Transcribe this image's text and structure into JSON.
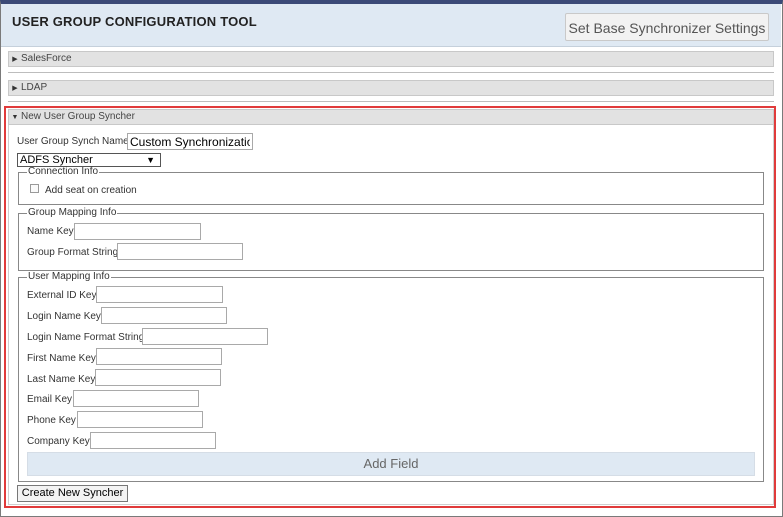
{
  "app": {
    "title": "USER GROUP CONFIGURATION TOOL",
    "base_settings_label": "Set Base Synchronizer Settings"
  },
  "accordions": [
    {
      "label": "SalesForce",
      "expanded": false
    },
    {
      "label": "LDAP",
      "expanded": false
    },
    {
      "label": "New User Group Syncher",
      "expanded": true
    }
  ],
  "form": {
    "synch_name_label": "User Group Synch Name",
    "synch_name_value": "Custom Synchronization",
    "syncher_type": "ADFS Syncher",
    "connection": {
      "legend": "Connection Info",
      "add_seat_label": "Add seat on creation",
      "add_seat_checked": false
    },
    "group_mapping": {
      "legend": "Group Mapping Info",
      "name_key_label": "Name Key",
      "name_key_value": "",
      "group_format_label": "Group Format String",
      "group_format_value": ""
    },
    "user_mapping": {
      "legend": "User Mapping Info",
      "external_id_label": "External ID Key",
      "login_name_label": "Login Name Key",
      "login_format_label": "Login Name Format String",
      "first_name_label": "First Name Key",
      "last_name_label": "Last Name Key",
      "email_label": "Email Key",
      "phone_label": "Phone Key",
      "company_label": "Company Key"
    },
    "add_field_label": "Add Field",
    "create_label": "Create New Syncher"
  },
  "colors": {
    "header_bg": "#dfe9f3",
    "top_bar": "#3b4a77",
    "highlight": "#e03b3b"
  }
}
